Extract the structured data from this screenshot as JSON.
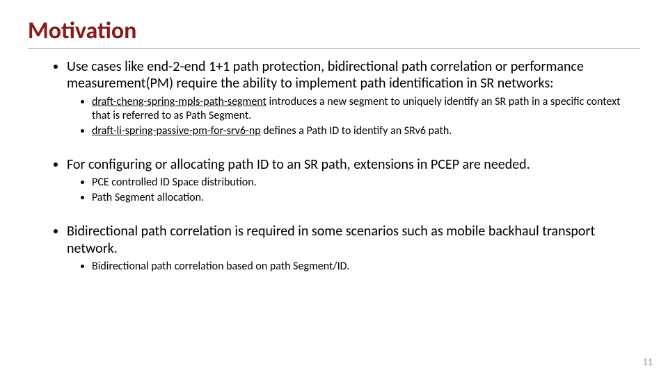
{
  "title": "Motivation",
  "bullets": [
    {
      "text": "Use cases like end-2-end 1+1 path protection, bidirectional path correlation or performance measurement(PM) require the ability to implement path identification in SR networks:",
      "sub": [
        {
          "lead": "draft-cheng-spring-mpls-path-segment",
          "rest": " introduces a new segment to uniquely identify an SR path in a specific context that is referred to as Path Segment."
        },
        {
          "lead": "draft-li-spring-passive-pm-for-srv6-np",
          "rest": " defines a Path ID to identify an SRv6 path."
        }
      ]
    },
    {
      "text": "For configuring or allocating path ID to an SR path, extensions in PCEP are needed.",
      "sub": [
        {
          "lead": "",
          "rest": "PCE controlled ID Space distribution."
        },
        {
          "lead": "",
          "rest": "Path Segment allocation."
        }
      ]
    },
    {
      "text": "Bidirectional path correlation is required in some scenarios such as mobile backhaul transport network.",
      "sub": [
        {
          "lead": "",
          "rest": "Bidirectional path correlation based on path Segment/ID."
        }
      ]
    }
  ],
  "page_number": "11"
}
